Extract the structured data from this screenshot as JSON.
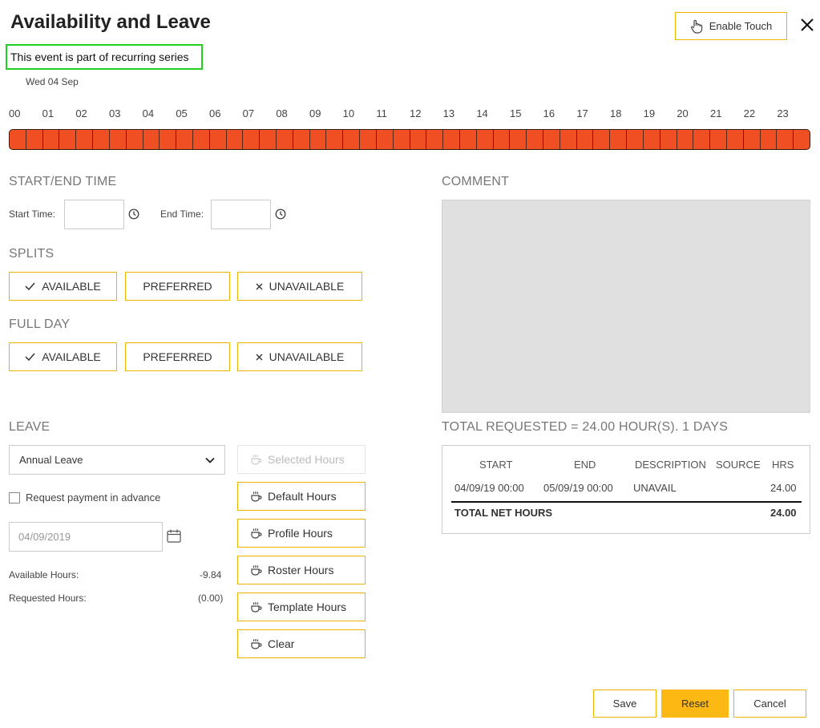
{
  "header": {
    "title": "Availability and Leave",
    "enable_touch_label": "Enable Touch",
    "recurring_notice": "This event is part of recurring series",
    "date": "Wed 04 Sep"
  },
  "timeline": {
    "hours": [
      "00",
      "01",
      "02",
      "03",
      "04",
      "05",
      "06",
      "07",
      "08",
      "09",
      "10",
      "11",
      "12",
      "13",
      "14",
      "15",
      "16",
      "17",
      "18",
      "19",
      "20",
      "21",
      "22",
      "23"
    ],
    "color": "#f04e23"
  },
  "start_end": {
    "heading": "START/END TIME",
    "start_label": "Start Time:",
    "end_label": "End Time:",
    "start_value": "",
    "end_value": ""
  },
  "splits": {
    "heading": "SPLITS",
    "available": "AVAILABLE",
    "preferred": "PREFERRED",
    "unavailable": "UNAVAILABLE"
  },
  "full_day": {
    "heading": "FULL DAY",
    "available": "AVAILABLE",
    "preferred": "PREFERRED",
    "unavailable": "UNAVAILABLE"
  },
  "comment": {
    "heading": "COMMENT"
  },
  "leave": {
    "heading": "LEAVE",
    "type_selected": "Annual Leave",
    "request_payment_label": "Request payment in advance",
    "date_value": "04/09/2019",
    "available_hours_label": "Available Hours:",
    "available_hours_value": "-9.84",
    "requested_hours_label": "Requested Hours:",
    "requested_hours_value": "(0.00)",
    "buttons": {
      "selected": "Selected Hours",
      "default": "Default Hours",
      "profile": "Profile Hours",
      "roster": "Roster Hours",
      "template": "Template Hours",
      "clear": "Clear"
    }
  },
  "summary": {
    "total_requested": "TOTAL REQUESTED = 24.00 HOUR(S). 1 DAYS",
    "columns": {
      "start": "START",
      "end": "END",
      "description": "DESCRIPTION",
      "source": "SOURCE",
      "hrs": "HRS"
    },
    "rows": [
      {
        "start": "04/09/19 00:00",
        "end": "05/09/19 00:00",
        "description": "UNAVAIL",
        "source": "",
        "hrs": "24.00"
      }
    ],
    "total_label": "TOTAL NET HOURS",
    "total_value": "24.00"
  },
  "footer": {
    "save": "Save",
    "reset": "Reset",
    "cancel": "Cancel"
  },
  "colors": {
    "accent": "#f0b400",
    "primary_button": "#fdb813",
    "timeline_fill": "#f04e23",
    "highlight_border": "#21d021"
  }
}
